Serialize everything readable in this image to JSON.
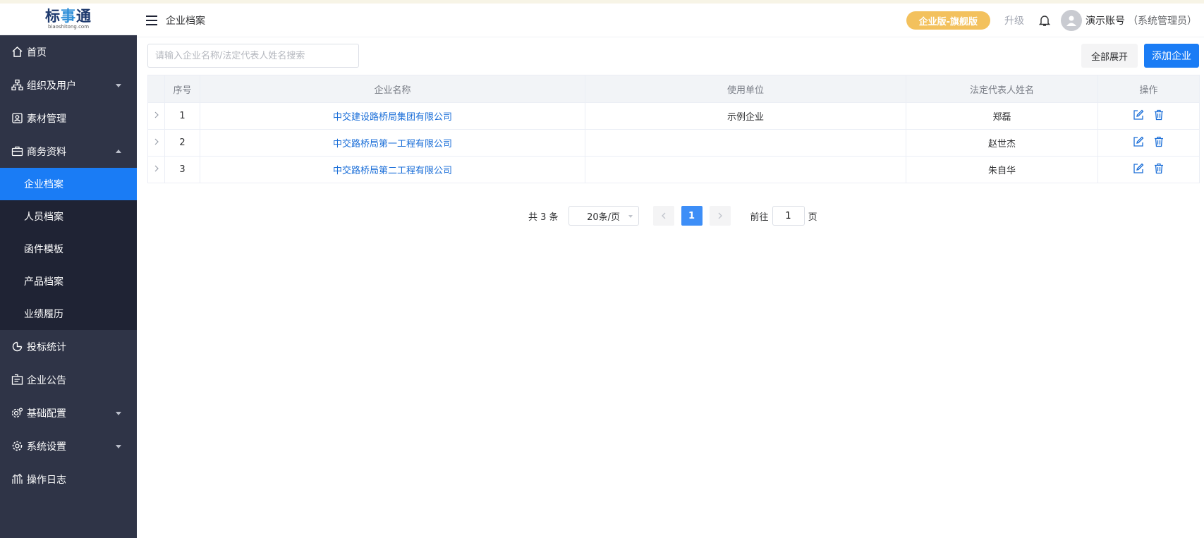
{
  "app": {
    "logo_text_a": "标",
    "logo_text_b": "事",
    "logo_text_c": "通",
    "logo_sub": "biaoshitong.com"
  },
  "header": {
    "breadcrumb": "企业档案",
    "edition_badge": "企业版-旗舰版",
    "upgrade_label": "升级",
    "user_name": "演示账号",
    "user_role": "（系统管理员）"
  },
  "sidebar": {
    "items": [
      {
        "label": "首页",
        "icon": "home-icon"
      },
      {
        "label": "组织及用户",
        "icon": "org-icon",
        "arrow": "down"
      },
      {
        "label": "素材管理",
        "icon": "material-icon"
      },
      {
        "label": "商务资料",
        "icon": "briefcase-icon",
        "arrow": "up"
      },
      {
        "label": "投标统计",
        "icon": "stats-icon"
      },
      {
        "label": "企业公告",
        "icon": "notice-icon"
      },
      {
        "label": "基础配置",
        "icon": "config-icon",
        "arrow": "down"
      },
      {
        "label": "系统设置",
        "icon": "settings-icon",
        "arrow": "down"
      },
      {
        "label": "操作日志",
        "icon": "log-icon"
      }
    ],
    "submenu": [
      {
        "label": "企业档案",
        "active": true
      },
      {
        "label": "人员档案"
      },
      {
        "label": "函件模板"
      },
      {
        "label": "产品档案"
      },
      {
        "label": "业绩履历"
      }
    ]
  },
  "toolbar": {
    "search_placeholder": "请输入企业名称/法定代表人姓名搜索",
    "expand_all_label": "全部展开",
    "add_label": "添加企业"
  },
  "table": {
    "columns": [
      "序号",
      "企业名称",
      "使用单位",
      "法定代表人姓名",
      "操作"
    ],
    "rows": [
      {
        "index": "1",
        "company": "中交建设路桥局集团有限公司",
        "unit": "示例企业",
        "legal_rep": "郑磊"
      },
      {
        "index": "2",
        "company": "中交路桥局第一工程有限公司",
        "unit": "",
        "legal_rep": "赵世杰"
      },
      {
        "index": "3",
        "company": "中交路桥局第二工程有限公司",
        "unit": "",
        "legal_rep": "朱自华"
      }
    ]
  },
  "pagination": {
    "total_text": "共 3 条",
    "page_size": "20条/页",
    "current_page": "1",
    "goto_prefix": "前往",
    "goto_value": "1",
    "goto_suffix": "页"
  },
  "colors": {
    "primary": "#1a7cf5",
    "sidebar_bg": "#2f3447",
    "submenu_bg": "#1f2334",
    "badge": "#f3c15d",
    "link": "#1a6ed8"
  }
}
